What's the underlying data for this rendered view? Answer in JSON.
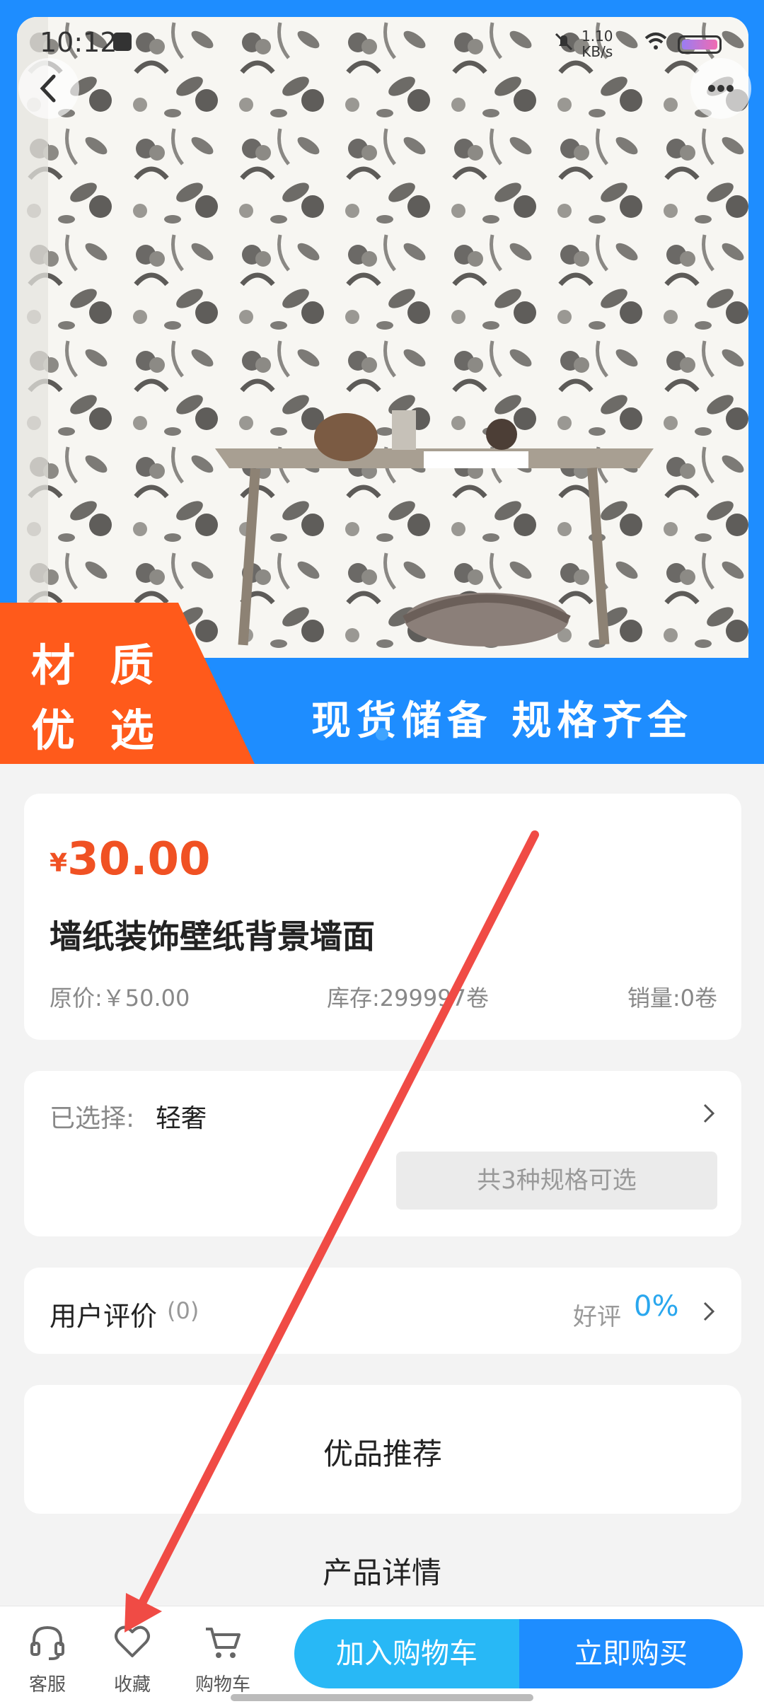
{
  "status": {
    "time": "10:12",
    "network_speed_line1": "1.10",
    "network_speed_line2": "KB/s"
  },
  "hero": {
    "badge_line1": "材 质",
    "badge_line2": "优 选",
    "banner_text": "现货储备 规格齐全"
  },
  "product": {
    "currency": "¥",
    "price": "30.00",
    "title": "墙纸装饰壁纸背景墙面",
    "original_price": "原价:￥50.00",
    "stock": "库存:299997卷",
    "sales": "销量:0卷"
  },
  "spec": {
    "label": "已选择:",
    "value": "轻奢",
    "options_button": "共3种规格可选"
  },
  "reviews": {
    "label": "用户评价",
    "count": "(0)",
    "good_label": "好评",
    "good_rate": "0%"
  },
  "sections": {
    "recommend": "优品推荐",
    "detail": "产品详情"
  },
  "bottom": {
    "service": "客服",
    "favorite": "收藏",
    "cart": "购物车",
    "add_to_cart": "加入购物车",
    "buy_now": "立即购买"
  },
  "colors": {
    "brand_blue": "#1e8dff",
    "price_orange": "#f05123",
    "badge_orange": "#ff5a1b",
    "cart_blue": "#28b8f6",
    "annotation_arrow": "#f04b45"
  }
}
